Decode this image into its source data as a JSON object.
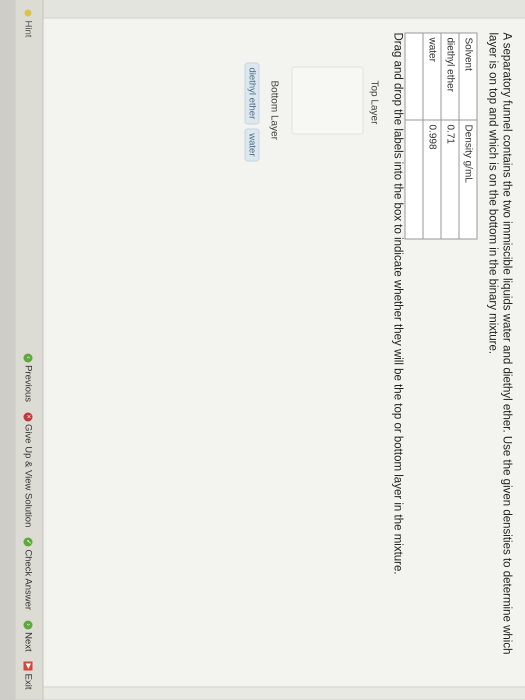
{
  "question": {
    "text": "A separatory funnel contains the two immiscible liquids water and diethyl ether. Use the given densities to determine which layer is on top and which is on the bottom in the binary mixture."
  },
  "table": {
    "headers": [
      "Solvent",
      "Density g/mL"
    ],
    "rows": [
      [
        "diethyl ether",
        "0.71"
      ],
      [
        "water",
        "0.998"
      ],
      [
        "",
        ""
      ]
    ]
  },
  "instruction": "Drag and drop the labels into the box to indicate whether they will be the top or bottom layer in the mixture.",
  "drop_targets": {
    "top_label": "Top Layer",
    "bottom_label": "Bottom Layer"
  },
  "chips": [
    "diethyl ether",
    "water"
  ],
  "footer": {
    "hint": "Hint",
    "previous": "Previous",
    "give_up": "Give Up & View Solution",
    "check": "Check Answer",
    "next": "Next",
    "exit": "Exit"
  },
  "icons": {
    "hint": "lightbulb-icon",
    "previous": "arrow-left-circle-icon",
    "give_up": "x-circle-icon",
    "check": "check-circle-icon",
    "next": "arrow-right-circle-icon",
    "exit": "exit-door-icon"
  }
}
